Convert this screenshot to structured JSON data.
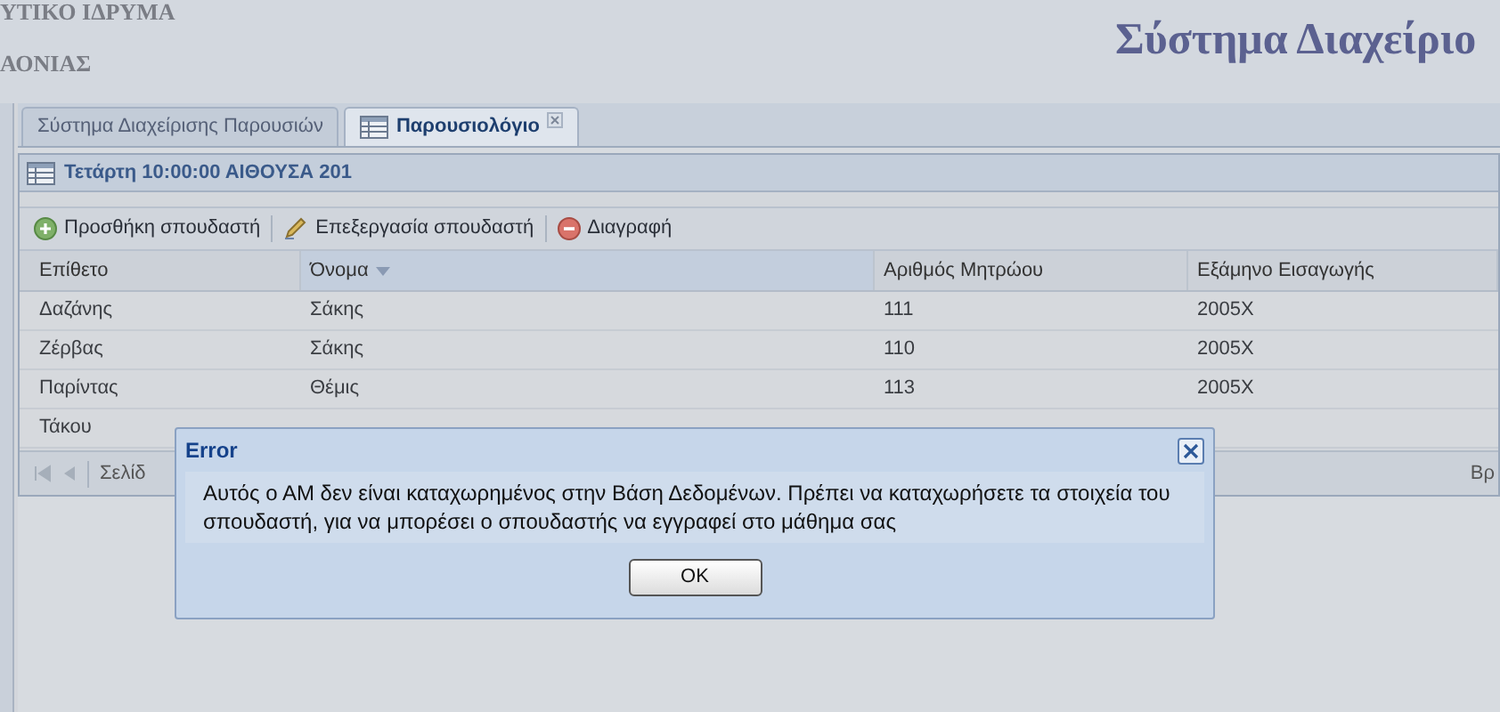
{
  "header": {
    "org_line_1": "ΥΤΙΚΟ ΙΔΡΥΜΑ",
    "org_line_2": "ΑΟΝΙΑΣ",
    "title": "Σύστημα Διαχείριο"
  },
  "tabs": [
    {
      "label": "Σύστημα Διαχείρισης Παρουσιών",
      "selected": false,
      "closable": false
    },
    {
      "label": "Παρουσιολόγιο",
      "selected": true,
      "closable": true
    }
  ],
  "panel": {
    "title": "Τετάρτη 10:00:00 ΑΙΘΟΥΣΑ 201",
    "toolbar": [
      {
        "label": "Προσθήκη σπουδαστή",
        "kind": "add"
      },
      {
        "label": "Επεξεργασία σπουδαστή",
        "kind": "edit"
      },
      {
        "label": "Διαγραφή",
        "kind": "delete"
      }
    ],
    "table": {
      "columns": [
        {
          "label": "Επίθετο",
          "sorted": false
        },
        {
          "label": "Όνομα",
          "sorted": true
        },
        {
          "label": "Αριθμός Μητρώου",
          "sorted": false
        },
        {
          "label": "Εξάμηνο Εισαγωγής",
          "sorted": false
        }
      ],
      "rows": [
        [
          "Δαζάνης",
          "Σάκης",
          "111",
          "2005Χ"
        ],
        [
          "Ζέρβας",
          "Σάκης",
          "110",
          "2005Χ"
        ],
        [
          "Παρίντας",
          "Θέμις",
          "113",
          "2005Χ"
        ],
        [
          "Τάκου"
        ]
      ]
    },
    "paging": {
      "page_label": "Σελίδ",
      "right_label": "Βρ"
    }
  },
  "dialog": {
    "title": "Error",
    "message": "Αυτός ο ΑΜ δεν είναι καταχωρημένος στην Βάση Δεδομένων. Πρέπει να καταχωρήσετε τα στοιχεία του σπουδαστή, για να μπορέσει ο σπουδαστής να εγγραφεί στο μάθημα σας",
    "button": "OK"
  }
}
